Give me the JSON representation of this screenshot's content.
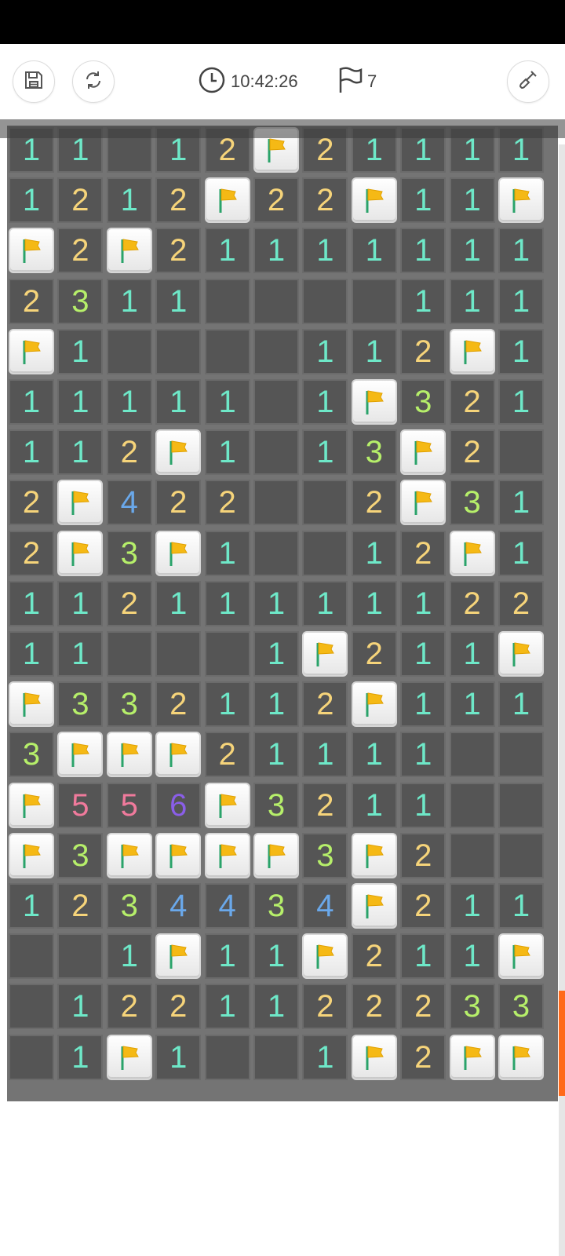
{
  "status_bar": {},
  "toolbar": {
    "save_icon": "floppy-disk-icon",
    "refresh_icon": "refresh-icon",
    "timer_icon": "clock-icon",
    "timer_value": "10:42:26",
    "flag_icon": "flag-outline-icon",
    "flag_count": "7",
    "dig_icon": "shovel-icon"
  },
  "colors": {
    "board_bg": "#747474",
    "cell_bg": "#555555",
    "accent": "#ff6a1a",
    "number_1": "#6ee8c8",
    "number_2": "#f6d47a",
    "number_3": "#b6ef6a",
    "number_4": "#6aa8ea",
    "number_5": "#f07a9c",
    "number_6": "#8a5ee8"
  },
  "board": {
    "columns": 11,
    "rows": [
      [
        "1",
        "1",
        "",
        "1",
        "2",
        "F",
        "2",
        "1",
        "1",
        "1",
        "1"
      ],
      [
        "1",
        "2",
        "1",
        "2",
        "F",
        "2",
        "2",
        "F",
        "1",
        "1",
        "F"
      ],
      [
        "F",
        "2",
        "F",
        "2",
        "1",
        "1",
        "1",
        "1",
        "1",
        "1",
        "1"
      ],
      [
        "2",
        "3",
        "1",
        "1",
        "",
        "",
        "",
        "",
        "1",
        "1",
        "1"
      ],
      [
        "F",
        "1",
        "",
        "",
        "",
        "",
        "1",
        "1",
        "2",
        "F",
        "1"
      ],
      [
        "1",
        "1",
        "1",
        "1",
        "1",
        "",
        "1",
        "F",
        "3",
        "2",
        "1"
      ],
      [
        "1",
        "1",
        "2",
        "F",
        "1",
        "",
        "1",
        "3",
        "F",
        "2",
        ""
      ],
      [
        "2",
        "F",
        "4",
        "2",
        "2",
        "",
        "",
        "2",
        "F",
        "3",
        "1"
      ],
      [
        "2",
        "F",
        "3",
        "F",
        "1",
        "",
        "",
        "1",
        "2",
        "F",
        "1"
      ],
      [
        "1",
        "1",
        "2",
        "1",
        "1",
        "1",
        "1",
        "1",
        "1",
        "2",
        "2"
      ],
      [
        "1",
        "1",
        "",
        "",
        "",
        "1",
        "F",
        "2",
        "1",
        "1",
        "F"
      ],
      [
        "F",
        "3",
        "3",
        "2",
        "1",
        "1",
        "2",
        "F",
        "1",
        "1",
        "1"
      ],
      [
        "3",
        "F",
        "F",
        "F",
        "2",
        "1",
        "1",
        "1",
        "1",
        "",
        ""
      ],
      [
        "F",
        "5",
        "5",
        "6",
        "F",
        "3",
        "2",
        "1",
        "1",
        "",
        ""
      ],
      [
        "F",
        "3",
        "F",
        "F",
        "F",
        "F",
        "3",
        "F",
        "2",
        "",
        ""
      ],
      [
        "1",
        "2",
        "3",
        "4",
        "4",
        "3",
        "4",
        "F",
        "2",
        "1",
        "1"
      ],
      [
        "",
        "",
        "1",
        "F",
        "1",
        "1",
        "F",
        "2",
        "1",
        "1",
        "F"
      ],
      [
        "",
        "1",
        "2",
        "2",
        "1",
        "1",
        "2",
        "2",
        "2",
        "3",
        "3"
      ],
      [
        "",
        "1",
        "F",
        "1",
        "",
        "",
        "1",
        "F",
        "2",
        "F",
        "F"
      ]
    ]
  }
}
